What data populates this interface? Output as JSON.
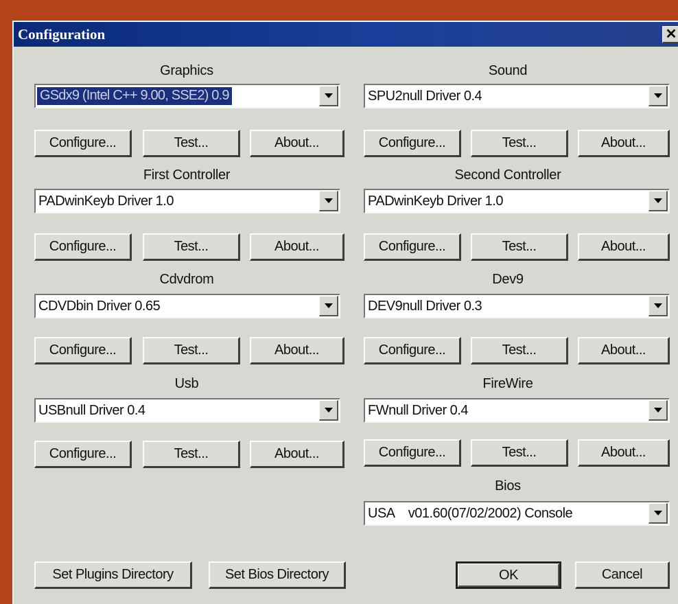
{
  "window": {
    "title": "Configuration",
    "close_glyph": "✕"
  },
  "graphics": {
    "label": "Graphics",
    "value": "GSdx9 (Intel C++ 9.00, SSE2) 0.9",
    "buttons": [
      "Configure...",
      "Test...",
      "About..."
    ]
  },
  "sound": {
    "label": "Sound",
    "value": "SPU2null Driver 0.4",
    "buttons": [
      "Configure...",
      "Test...",
      "About..."
    ]
  },
  "first_controller": {
    "label": "First Controller",
    "value": "PADwinKeyb Driver 1.0",
    "buttons": [
      "Configure...",
      "Test...",
      "About..."
    ]
  },
  "second_controller": {
    "label": "Second Controller",
    "value": "PADwinKeyb Driver 1.0",
    "buttons": [
      "Configure...",
      "Test...",
      "About..."
    ]
  },
  "cdvdrom": {
    "label": "Cdvdrom",
    "value": "CDVDbin Driver 0.65",
    "buttons": [
      "Configure...",
      "Test...",
      "About..."
    ]
  },
  "dev9": {
    "label": "Dev9",
    "value": "DEV9null Driver 0.3",
    "buttons": [
      "Configure...",
      "Test...",
      "About..."
    ]
  },
  "usb": {
    "label": "Usb",
    "value": "USBnull Driver 0.4",
    "buttons": [
      "Configure...",
      "Test...",
      "About..."
    ]
  },
  "firewire": {
    "label": "FireWire",
    "value": "FWnull Driver 0.4",
    "buttons": [
      "Configure...",
      "Test...",
      "About..."
    ]
  },
  "bios": {
    "label": "Bios",
    "value": "USA    v01.60(07/02/2002) Console"
  },
  "footer": {
    "set_plugins": "Set Plugins Directory",
    "set_bios": "Set Bios Directory",
    "ok": "OK",
    "cancel": "Cancel"
  },
  "colors": {
    "titlebar": "#0a2a78",
    "dialog_bg": "#d8d8d2",
    "desktop": "#b5441c",
    "selection": "#1b2f7a"
  },
  "icons": {
    "close": "close-icon",
    "dropdown": "chevron-down-icon"
  }
}
